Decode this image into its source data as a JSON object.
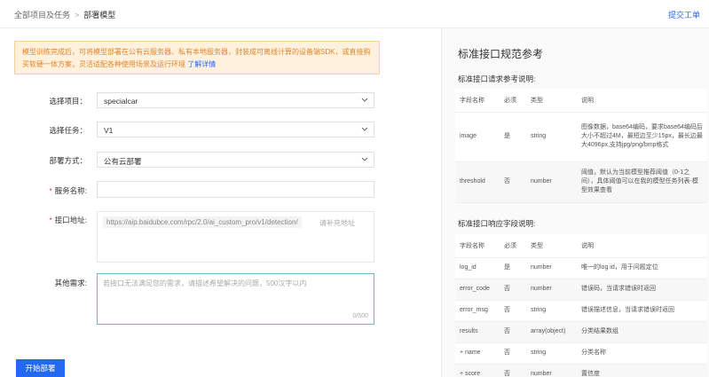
{
  "breadcrumb": {
    "parent": "全部项目及任务",
    "separator": ">",
    "current": "部署模型"
  },
  "header": {
    "ticket_link": "提交工单"
  },
  "notice": {
    "text": "模型训练完成后，可将模型部署在公有云服务器、私有本地服务器，封装成可离线计算的设备端SDK，或直接购买软硬一体方案，灵活适配各种使用场景及运行环境",
    "link": "了解详情"
  },
  "form": {
    "project_label": "选择项目：",
    "project_value": "specialcar",
    "task_label": "选择任务：",
    "task_value": "V1",
    "deploy_label": "部署方式：",
    "deploy_value": "公有云部署",
    "service_label": "服务名称:",
    "service_value": "",
    "address_label": "接口地址:",
    "address_fixed": "https://aip.baidubce.com/rpc/2.0/ai_custom_pro/v1/detection/",
    "address_placeholder": "请补充地址",
    "other_label": "其他需求:",
    "other_placeholder": "若接口无法满足您的需求，请描述希望解决的问题，500汉字以内",
    "other_counter": "0/500",
    "required_mark": "*"
  },
  "submit_button": "开始部署",
  "spec": {
    "title": "标准接口规范参考",
    "request_title": "标准接口请求参考说明:",
    "request_headers": [
      "字段名称",
      "必须",
      "类型",
      "说明"
    ],
    "request_rows": [
      [
        "image",
        "是",
        "string",
        "图像数据，base64编码，要求base64编码后大小不超过4M，最短边至少15px，最长边最大4096px,支持jpg/png/bmp格式"
      ],
      [
        "threshold",
        "否",
        "number",
        "阈值，默认为当前模型推荐阈值（0-1之间），具体阈值可以在我的模型任务列表-模型效果查看"
      ]
    ],
    "response_title": "标准接口响应字段说明:",
    "response_headers": [
      "字段名称",
      "必须",
      "类型",
      "说明"
    ],
    "response_rows": [
      [
        "log_id",
        "是",
        "number",
        "唯一的log id，用于问题定位"
      ],
      [
        "error_code",
        "否",
        "number",
        "错误码，当请求错误时返回"
      ],
      [
        "error_msg",
        "否",
        "string",
        "错误描述信息，当请求错误时返回"
      ],
      [
        "results",
        "否",
        "array(object)",
        "分类结果数组"
      ],
      [
        "+ name",
        "否",
        "string",
        "分类名称"
      ],
      [
        "+ score",
        "否",
        "number",
        "置信度"
      ]
    ]
  }
}
